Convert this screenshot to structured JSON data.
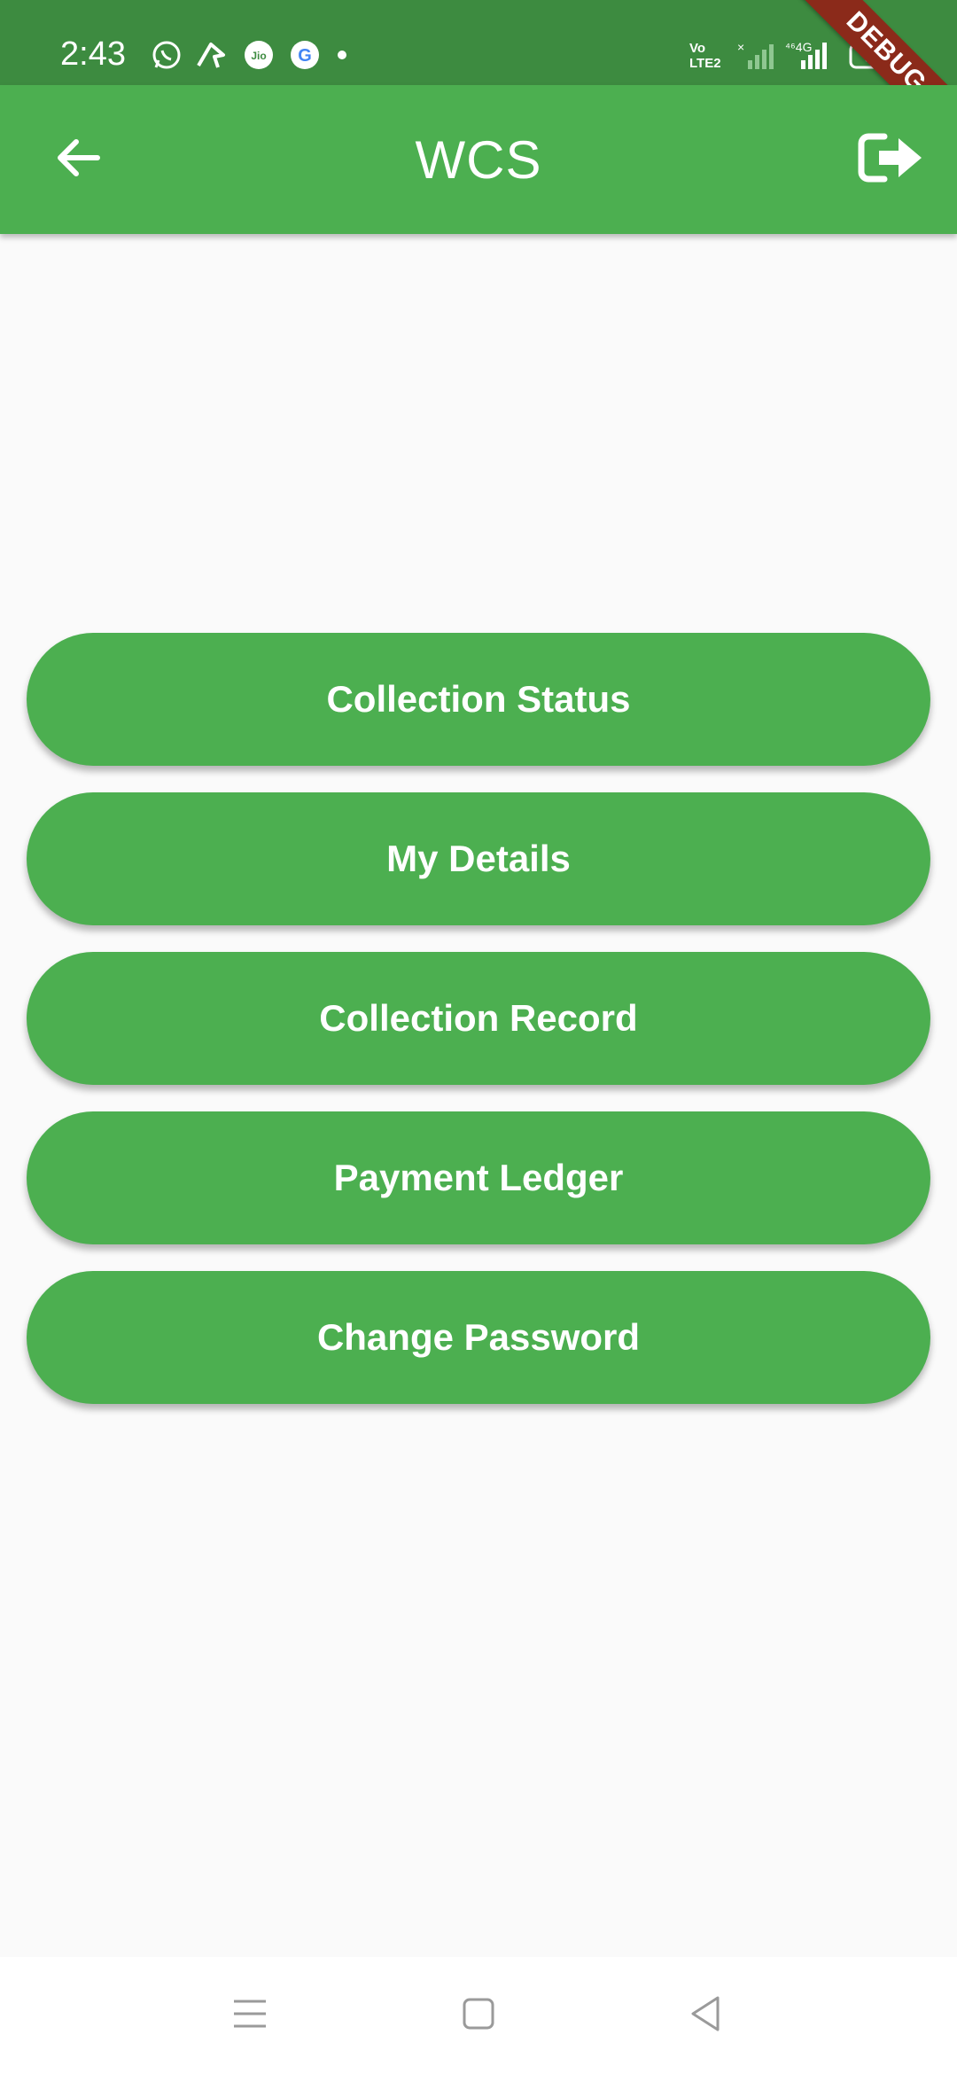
{
  "status_bar": {
    "time": "2:43",
    "network_label": "4G",
    "volte_label": "Vo LTE2",
    "battery_level": "33"
  },
  "debug_ribbon": {
    "label": "DEBUG"
  },
  "app_bar": {
    "title": "WCS",
    "back_icon": "arrow-back-icon",
    "logout_icon": "logout-icon",
    "color": "#4caf50"
  },
  "menu": {
    "items": [
      {
        "label": "Collection Status"
      },
      {
        "label": "My Details"
      },
      {
        "label": "Collection Record"
      },
      {
        "label": "Payment Ledger"
      },
      {
        "label": "Change Password"
      }
    ]
  },
  "nav_bar": {
    "icons": [
      "menu-icon",
      "home-square-icon",
      "back-triangle-icon"
    ]
  }
}
